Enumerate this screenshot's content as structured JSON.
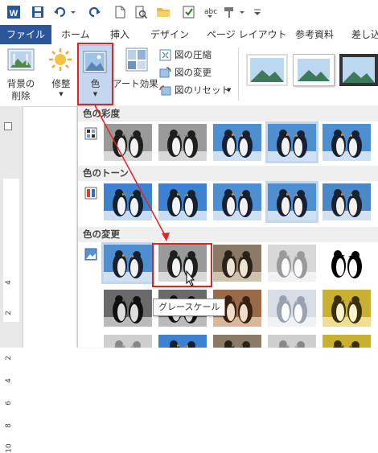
{
  "ribbon_tabs": {
    "file": "ファイル",
    "home": "ホーム",
    "insert": "挿入",
    "design": "デザイン",
    "page_layout": "ページ レイアウト",
    "references": "参考資料",
    "mailings": "差し込"
  },
  "adjust_group": {
    "remove_background": [
      "背景の",
      "削除"
    ],
    "corrections": "修整",
    "color": "色",
    "artistic_effects": "アート効果",
    "compress_pictures": "図の圧縮",
    "change_picture": "図の変更",
    "reset_picture": "図のリセット"
  },
  "color_gallery": {
    "saturation_header": "色の彩度",
    "tone_header": "色のトーン",
    "recolor_header": "色の変更",
    "tooltip": "グレースケール"
  },
  "ruler_numbers": [
    "4",
    "2",
    "2",
    "4",
    "6",
    "8",
    "10"
  ],
  "colors": {
    "file_tab": "#2b579a",
    "highlight_border": "#e0231c",
    "selection_outline": "#c5d5ea"
  }
}
